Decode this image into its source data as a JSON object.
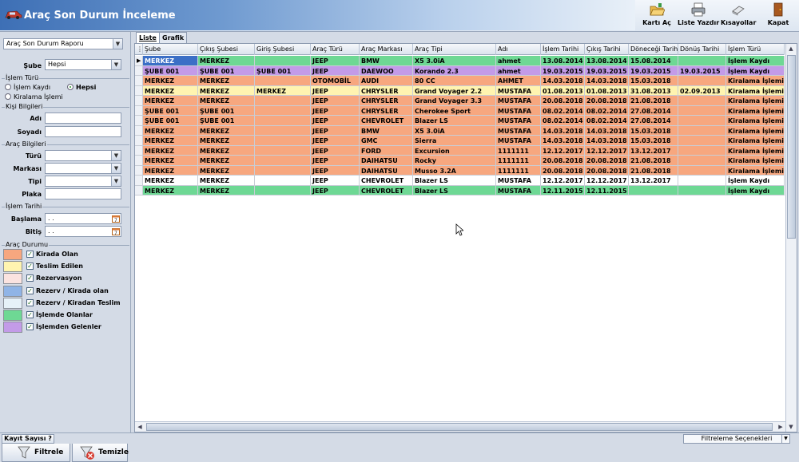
{
  "app": {
    "title": "Araç Son Durum İnceleme"
  },
  "toolbar": {
    "card_open": "Kartı Aç",
    "print_list": "Liste Yazdır",
    "shortcuts": "Kısayollar",
    "close": "Kapat"
  },
  "sidebar": {
    "report_select": "Araç Son Durum Raporu",
    "branch_label": "Şube",
    "branch_value": "Hepsi",
    "op_type_title": "İşlem Türü",
    "op_options": [
      "İşlem Kaydı",
      "Hepsi",
      "Kiralama İşlemi"
    ],
    "op_selected": "Hepsi",
    "person_title": "Kişi Bilgileri",
    "first_name_label": "Adı",
    "last_name_label": "Soyadı",
    "vehicle_title": "Araç Bilgileri",
    "type_label": "Türü",
    "brand_label": "Markası",
    "model_label": "Tipi",
    "plate_label": "Plaka",
    "date_title": "İşlem Tarihi",
    "start_label": "Başlama",
    "end_label": "Bitiş",
    "date_placeholder": ". .",
    "status_title": "Araç Durumu",
    "legend": [
      {
        "label": "Kirada Olan",
        "color": "#f7a77f",
        "checked": true
      },
      {
        "label": "Teslim Edilen",
        "color": "#fff4b0",
        "checked": true
      },
      {
        "label": "Rezervasyon",
        "color": "#fbe3e0",
        "checked": true
      },
      {
        "label": "Rezerv / Kirada olan",
        "color": "#90b4e6",
        "checked": true
      },
      {
        "label": "Rezerv / Kiradan Teslim",
        "color": "#e6f1f8",
        "checked": true
      },
      {
        "label": "İşlemde Olanlar",
        "color": "#6ed894",
        "checked": true
      },
      {
        "label": "İşlemden Gelenler",
        "color": "#c39be8",
        "checked": true
      }
    ],
    "filter_button": "Filtrele",
    "clear_button": "Temizle"
  },
  "tabs": [
    {
      "label": "Liste",
      "active": true
    },
    {
      "label": "Grafik",
      "active": false
    }
  ],
  "grid": {
    "columns": [
      "Şube",
      "Çıkış Şubesi",
      "Giriş Şubesi",
      "Araç Türü",
      "Araç Markası",
      "Araç Tipi",
      "Adı",
      "İşlem Tarihi",
      "Çıkış Tarihi",
      "Döneceği Tarihi",
      "Dönüş Tarihi",
      "İşlem Türü"
    ],
    "rows": [
      {
        "color": "#6ed894",
        "cells": [
          "MERKEZ",
          "MERKEZ",
          "",
          "JEEP",
          "BMW",
          "X5 3.0iA",
          "ahmet",
          "13.08.2014",
          "13.08.2014",
          "15.08.2014",
          "",
          "İşlem Kaydı"
        ]
      },
      {
        "color": "#c39be8",
        "cells": [
          "ŞUBE 001",
          "ŞUBE 001",
          "ŞUBE 001",
          "JEEP",
          "DAEWOO",
          "Korando 2.3",
          "ahmet",
          "19.03.2015",
          "19.03.2015",
          "19.03.2015",
          "19.03.2015",
          "İşlem Kaydı"
        ]
      },
      {
        "color": "#f7a77f",
        "cells": [
          "MERKEZ",
          "MERKEZ",
          "",
          "OTOMOBİL",
          "AUDI",
          "80 CC",
          "AHMET",
          "14.03.2018",
          "14.03.2018",
          "15.03.2018",
          "",
          "Kiralama İşlemi"
        ]
      },
      {
        "color": "#fff4b0",
        "cells": [
          "MERKEZ",
          "MERKEZ",
          "MERKEZ",
          "JEEP",
          "CHRYSLER",
          "Grand Voyager 2.2",
          "MUSTAFA",
          "01.08.2013",
          "01.08.2013",
          "31.08.2013",
          "02.09.2013",
          "Kiralama İşlemi"
        ]
      },
      {
        "color": "#f7a77f",
        "cells": [
          "MERKEZ",
          "MERKEZ",
          "",
          "JEEP",
          "CHRYSLER",
          "Grand Voyager 3.3",
          "MUSTAFA",
          "20.08.2018",
          "20.08.2018",
          "21.08.2018",
          "",
          "Kiralama İşlemi"
        ]
      },
      {
        "color": "#f7a77f",
        "cells": [
          "ŞUBE 001",
          "ŞUBE 001",
          "",
          "JEEP",
          "CHRYSLER",
          "Cherokee Sport",
          "MUSTAFA",
          "08.02.2014",
          "08.02.2014",
          "27.08.2014",
          "",
          "Kiralama İşlemi"
        ]
      },
      {
        "color": "#f7a77f",
        "cells": [
          "ŞUBE 001",
          "ŞUBE 001",
          "",
          "JEEP",
          "CHEVROLET",
          "Blazer LS",
          "MUSTAFA",
          "08.02.2014",
          "08.02.2014",
          "27.08.2014",
          "",
          "Kiralama İşlemi"
        ]
      },
      {
        "color": "#f7a77f",
        "cells": [
          "MERKEZ",
          "MERKEZ",
          "",
          "JEEP",
          "BMW",
          "X5 3.0iA",
          "MUSTAFA",
          "14.03.2018",
          "14.03.2018",
          "15.03.2018",
          "",
          "Kiralama İşlemi"
        ]
      },
      {
        "color": "#f7a77f",
        "cells": [
          "MERKEZ",
          "MERKEZ",
          "",
          "JEEP",
          "GMC",
          "Sierra",
          "MUSTAFA",
          "14.03.2018",
          "14.03.2018",
          "15.03.2018",
          "",
          "Kiralama İşlemi"
        ]
      },
      {
        "color": "#f7a77f",
        "cells": [
          "MERKEZ",
          "MERKEZ",
          "",
          "JEEP",
          "FORD",
          "Excursion",
          "1111111",
          "12.12.2017",
          "12.12.2017",
          "13.12.2017",
          "",
          "Kiralama İşlemi"
        ]
      },
      {
        "color": "#f7a77f",
        "cells": [
          "MERKEZ",
          "MERKEZ",
          "",
          "JEEP",
          "DAIHATSU",
          "Rocky",
          "1111111",
          "20.08.2018",
          "20.08.2018",
          "21.08.2018",
          "",
          "Kiralama İşlemi"
        ]
      },
      {
        "color": "#f7a77f",
        "cells": [
          "MERKEZ",
          "MERKEZ",
          "",
          "JEEP",
          "DAIHATSU",
          "Musso 3.2A",
          "1111111",
          "20.08.2018",
          "20.08.2018",
          "21.08.2018",
          "",
          "Kiralama İşlemi"
        ]
      },
      {
        "color": "#ffffff",
        "cells": [
          "MERKEZ",
          "MERKEZ",
          "",
          "JEEP",
          "CHEVROLET",
          "Blazer LS",
          "MUSTAFA",
          "12.12.2017",
          "12.12.2017",
          "13.12.2017",
          "",
          "İşlem Kaydı"
        ]
      },
      {
        "color": "#6ed894",
        "cells": [
          "MERKEZ",
          "MERKEZ",
          "",
          "JEEP",
          "CHEVROLET",
          "Blazer LS",
          "MUSTAFA",
          "12.11.2015",
          "12.11.2015",
          "",
          "",
          "İşlem Kaydı"
        ]
      }
    ]
  },
  "status": {
    "count_button": "Kayıt Sayısı ?",
    "filter_options": "Filtreleme Seçenekleri"
  }
}
